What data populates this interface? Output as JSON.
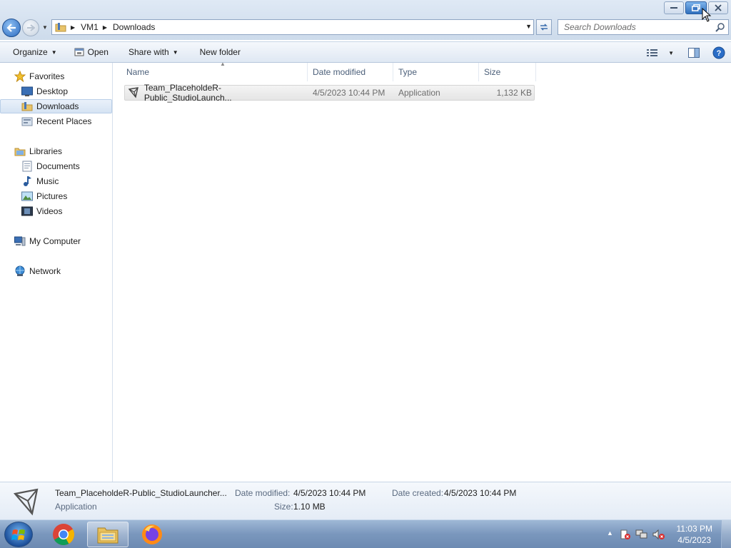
{
  "window": {
    "controls": [
      "minimize",
      "restore",
      "close"
    ]
  },
  "navigation": {
    "breadcrumbs": [
      "VM1",
      "Downloads"
    ],
    "search_placeholder": "Search Downloads"
  },
  "toolbar": {
    "organize_label": "Organize",
    "open_label": "Open",
    "share_label": "Share with",
    "new_folder_label": "New folder"
  },
  "sidebar": {
    "favorites_label": "Favorites",
    "favorites": [
      "Desktop",
      "Downloads",
      "Recent Places"
    ],
    "libraries_label": "Libraries",
    "libraries": [
      "Documents",
      "Music",
      "Pictures",
      "Videos"
    ],
    "computer_label": "My Computer",
    "network_label": "Network",
    "selected": "Downloads"
  },
  "file_list": {
    "columns": [
      "Name",
      "Date modified",
      "Type",
      "Size"
    ],
    "rows": [
      {
        "name": "Team_PlaceholdeR-Public_StudioLaunch...",
        "date_modified": "4/5/2023 10:44 PM",
        "type": "Application",
        "size": "1,132 KB"
      }
    ]
  },
  "details": {
    "name": "Team_PlaceholdeR-Public_StudioLauncher...",
    "type": "Application",
    "date_modified_label": "Date modified:",
    "date_modified": "4/5/2023 10:44 PM",
    "size_label": "Size:",
    "size": "1.10 MB",
    "date_created_label": "Date created:",
    "date_created": "4/5/2023 10:44 PM"
  },
  "taskbar": {
    "apps": [
      "chrome-icon",
      "explorer-icon",
      "firefox-icon"
    ],
    "active_app": "explorer-icon",
    "time": "11:03 PM",
    "date": "4/5/2023"
  },
  "colors": {
    "accent": "#1e395b",
    "selection": "#d5e3f3",
    "taskbar": "#7a97bd"
  }
}
